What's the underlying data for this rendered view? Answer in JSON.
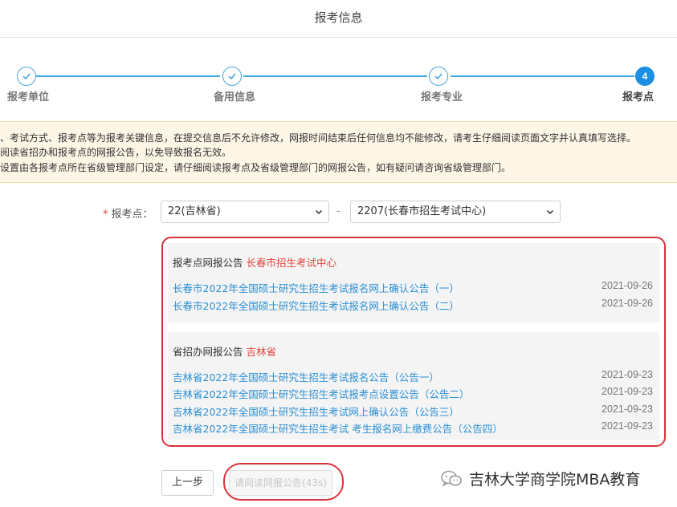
{
  "header": {
    "title": "报考信息"
  },
  "steps": [
    {
      "label": "报考单位",
      "state": "done",
      "icon": "check-icon"
    },
    {
      "label": "备用信息",
      "state": "done",
      "icon": "check-icon"
    },
    {
      "label": "报考专业",
      "state": "done",
      "icon": "check-icon"
    },
    {
      "label": "报考点",
      "state": "active",
      "number": "4"
    }
  ],
  "notice": {
    "lines": [
      "、考试方式、报考点等为报考关键信息，在提交信息后不允许修改，网报时间结束后任何信息均不能修改，请考生仔细阅读页面文字并认真填写选择。",
      "阅读省招办和报考点的网报公告，以免导致报名无效。",
      "设置由各报考点所在省级管理部门设定，请仔细阅读报考点及省级管理部门的网报公告，如有疑问请咨询省级管理部门。"
    ]
  },
  "form": {
    "required_mark": "*",
    "label": "报考点：",
    "province_select": "22(吉林省)",
    "separator": "-",
    "site_select": "2207(长春市招生考试中心)"
  },
  "announcements": {
    "site": {
      "heading": "报考点网报公告",
      "highlight": "长春市招生考试中心",
      "items": [
        {
          "title": "长春市2022年全国硕士研究生招生考试报名网上确认公告（一）",
          "date": "2021-09-26"
        },
        {
          "title": "长春市2022年全国硕士研究生招生考试报名网上确认公告（二）",
          "date": "2021-09-26"
        }
      ]
    },
    "province": {
      "heading": "省招办网报公告",
      "highlight": "吉林省",
      "items": [
        {
          "title": "吉林省2022年全国硕士研究生招生考试报名公告（公告一）",
          "date": "2021-09-23"
        },
        {
          "title": "吉林省2022年全国硕士研究生招生考试报考点设置公告（公告二）",
          "date": "2021-09-23"
        },
        {
          "title": "吉林省2022年全国硕士研究生招生考试网上确认公告（公告三）",
          "date": "2021-09-23"
        },
        {
          "title": "吉林省2022年全国硕士研究生招生考试 考生报名网上缴费公告（公告四）",
          "date": "2021-09-23"
        }
      ]
    }
  },
  "buttons": {
    "prev": "上一步",
    "read": "请阅读网报公告(43s)"
  },
  "watermark": {
    "text": "吉林大学商学院MBA教育",
    "icon": "wechat-icon"
  },
  "colors": {
    "accent": "#1a8fe3",
    "link": "#2b8fd4",
    "highlight": "#e2453c",
    "annotation_border": "#d9323a",
    "notice_bg": "#fdf6e7"
  }
}
